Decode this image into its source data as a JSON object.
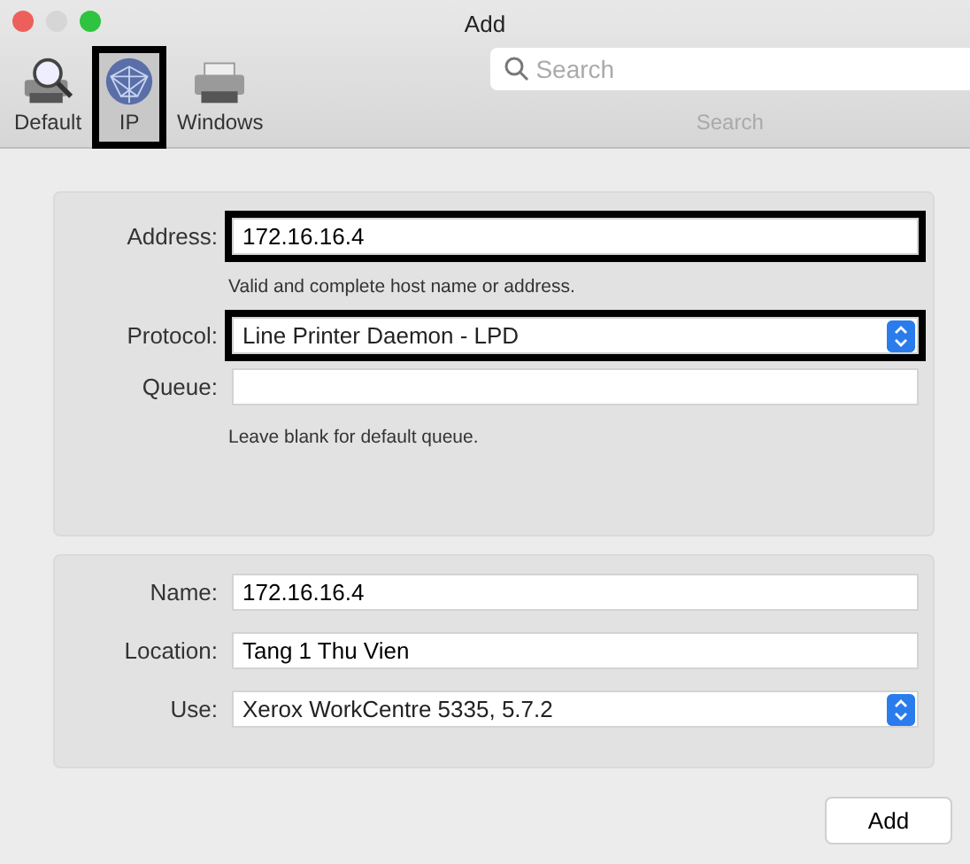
{
  "window": {
    "title": "Add",
    "controls": [
      {
        "color": "#ec5f5a"
      },
      {
        "color": "#d6d6d6"
      },
      {
        "color": "#2fc440"
      }
    ]
  },
  "toolbar": {
    "tabs": [
      {
        "label": "Default",
        "kind": "default",
        "selected": false,
        "highlighted": false
      },
      {
        "label": "IP",
        "kind": "ip",
        "selected": true,
        "highlighted": true
      },
      {
        "label": "Windows",
        "kind": "windows",
        "selected": false,
        "highlighted": false
      }
    ],
    "search": {
      "placeholder": "Search",
      "label": "Search"
    }
  },
  "connection": {
    "fields": [
      {
        "label": "Address:",
        "kind": "text",
        "value": "172.16.16.4",
        "highlighted": true,
        "hint": "Valid and complete host name or address."
      },
      {
        "label": "Protocol:",
        "kind": "select",
        "value": "Line Printer Daemon - LPD",
        "highlighted": true
      },
      {
        "label": "Queue:",
        "kind": "text",
        "highlighted": false,
        "hint": "Leave blank for default queue."
      }
    ]
  },
  "printer": {
    "fields": [
      {
        "label": "Name:",
        "kind": "text",
        "value": "172.16.16.4",
        "highlighted": false
      },
      {
        "label": "Location:",
        "kind": "text",
        "value": "Tang 1 Thu Vien",
        "highlighted": false
      },
      {
        "label": "Use:",
        "kind": "select",
        "value": "Xerox WorkCentre 5335, 5.7.2",
        "highlighted": false
      }
    ]
  },
  "buttons": [
    "Add"
  ]
}
